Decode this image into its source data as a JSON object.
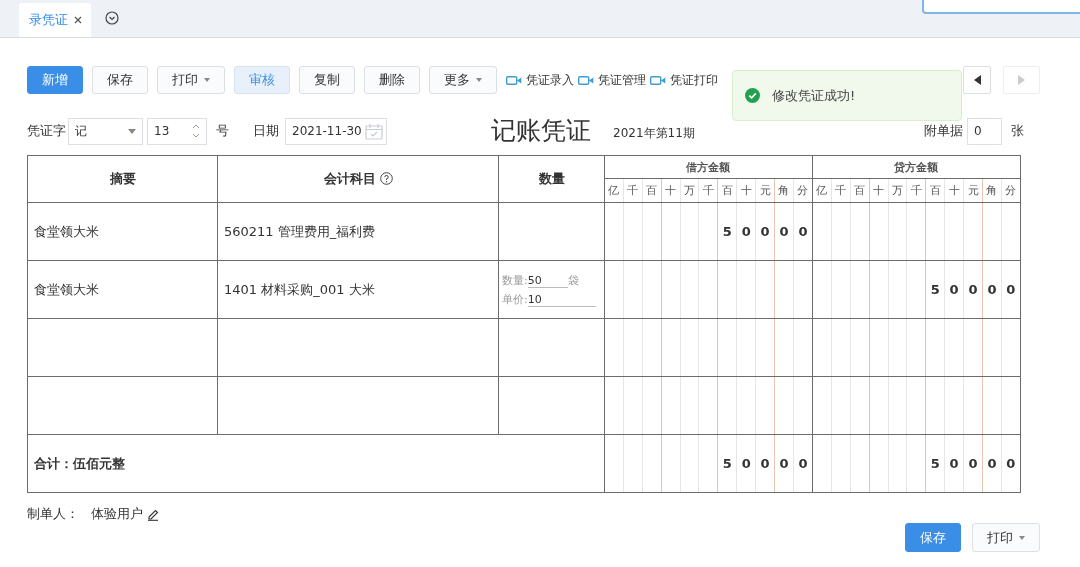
{
  "tabs": [
    {
      "label": "录凭证",
      "selected": true
    }
  ],
  "toolbar": {
    "buttons": [
      {
        "label": "新增",
        "kind": "primary",
        "dropdown": false
      },
      {
        "label": "保存",
        "kind": "default",
        "dropdown": false
      },
      {
        "label": "打印",
        "kind": "default",
        "dropdown": true
      },
      {
        "label": "审核",
        "kind": "light",
        "dropdown": false
      },
      {
        "label": "复制",
        "kind": "default",
        "dropdown": false
      },
      {
        "label": "删除",
        "kind": "default",
        "dropdown": false
      },
      {
        "label": "更多",
        "kind": "default",
        "dropdown": true
      }
    ],
    "video_links": [
      "凭证录入",
      "凭证管理",
      "凭证打印"
    ]
  },
  "toast": {
    "message": "修改凭证成功!"
  },
  "header": {
    "voucher_word_label": "凭证字",
    "voucher_word": "记",
    "number": "13",
    "number_label": "号",
    "date_label": "日期",
    "date": "2021-11-30",
    "title": "记账凭证",
    "period": "2021年第11期",
    "attachments_label": "附单据",
    "attachments": "0",
    "attachments_unit": "张"
  },
  "table": {
    "columns": [
      "摘要",
      "会计科目",
      "数量"
    ],
    "debit": {
      "title": "借方金额",
      "units": [
        "亿",
        "千",
        "百",
        "十",
        "万",
        "千",
        "百",
        "十",
        "元",
        "角",
        "分"
      ]
    },
    "credit": {
      "title": "贷方金额",
      "units": [
        "亿",
        "千",
        "百",
        "十",
        "万",
        "千",
        "百",
        "十",
        "元",
        "角",
        "分"
      ]
    },
    "rows": [
      {
        "summary": "食堂领大米",
        "account": "560211 管理费用_福利费",
        "debit": [
          "5",
          "0",
          "0",
          "0",
          "0"
        ]
      },
      {
        "summary": "食堂领大米",
        "account": "1401 材料采购_001 大米",
        "quantity": {
          "qty_label": "数量:",
          "qty": "50",
          "unit": "袋",
          "price_label": "单价:",
          "price": "10"
        },
        "credit": [
          "5",
          "0",
          "0",
          "0",
          "0"
        ]
      },
      {},
      {}
    ],
    "total": {
      "label": "合计：伍佰元整",
      "debit": [
        "5",
        "0",
        "0",
        "0",
        "0"
      ],
      "credit": [
        "5",
        "0",
        "0",
        "0",
        "0"
      ]
    }
  },
  "footer": {
    "maker_label": "制单人：",
    "maker": "体验用户",
    "buttons": [
      {
        "label": "保存",
        "kind": "primary",
        "dropdown": false
      },
      {
        "label": "打印",
        "kind": "default",
        "dropdown": true
      }
    ]
  }
}
